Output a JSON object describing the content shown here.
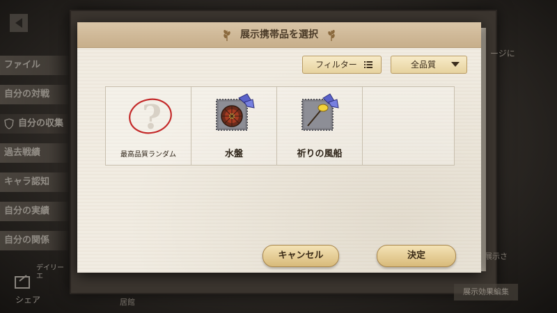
{
  "dialog": {
    "title": "展示携帯品を選択",
    "filter_label": "フィルター",
    "quality_selected": "全品質",
    "cancel_label": "キャンセル",
    "confirm_label": "決定"
  },
  "items": [
    {
      "label": "最高品質ランダム",
      "icon": "random-question-icon"
    },
    {
      "label": "水盤",
      "icon": "water-basin-icon"
    },
    {
      "label": "祈りの風船",
      "icon": "prayer-balloon-icon"
    },
    {
      "label": "",
      "icon": ""
    }
  ],
  "background": {
    "side_menu": [
      {
        "label": "ファイル"
      },
      {
        "label": "自分の対戦"
      },
      {
        "label": "自分の収集"
      },
      {
        "label": "過去戦績"
      },
      {
        "label": "キャラ認知"
      },
      {
        "label": "自分の実績"
      },
      {
        "label": "自分の関係"
      }
    ],
    "daily_label": "デイリー\nエ",
    "share_label": "シェア",
    "right_text_1": "ージに",
    "right_text_2": "展示さ",
    "effect_edit_label": "展示効果編集",
    "bottom_text": "居館"
  },
  "colors": {
    "header": "#c7ae8a",
    "panel": "#f1ece2",
    "button": "#e7d39f",
    "accent_red": "#c42a2a",
    "butterfly": "#5a62c9"
  }
}
